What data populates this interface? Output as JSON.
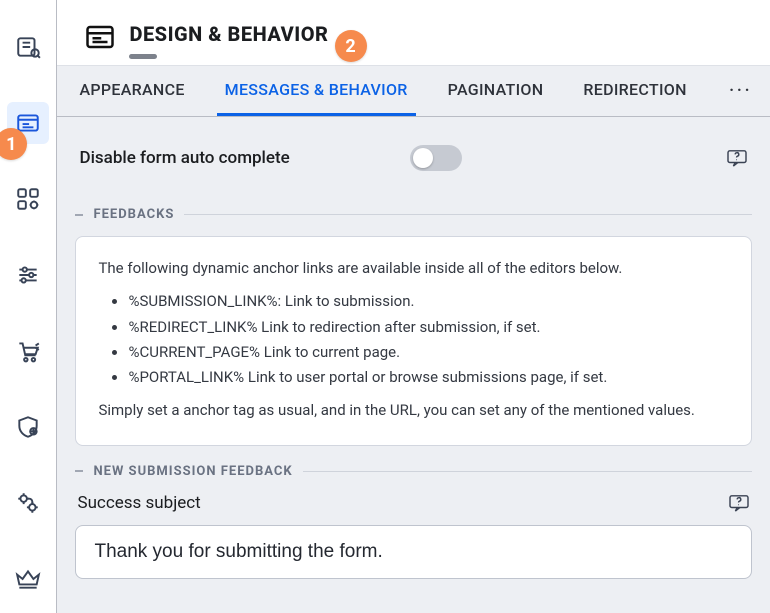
{
  "header": {
    "title": "DESIGN & BEHAVIOR"
  },
  "tabs": {
    "items": [
      {
        "label": "APPEARANCE"
      },
      {
        "label": "MESSAGES & BEHAVIOR"
      },
      {
        "label": "PAGINATION"
      },
      {
        "label": "REDIRECTION"
      }
    ],
    "more": "···"
  },
  "autocomplete": {
    "label": "Disable form auto complete"
  },
  "sections": {
    "feedbacks": {
      "title": "FEEDBACKS"
    },
    "newSubmission": {
      "title": "NEW SUBMISSION FEEDBACK"
    }
  },
  "feedbackCard": {
    "intro": "The following dynamic anchor links are available inside all of the editors below.",
    "items": {
      "0": "%SUBMISSION_LINK%: Link to submission.",
      "1": "%REDIRECT_LINK% Link to redirection after submission, if set.",
      "2": "%CURRENT_PAGE% Link to current page.",
      "3": "%PORTAL_LINK% Link to user portal or browse submissions page, if set."
    },
    "outro": "Simply set a anchor tag as usual, and in the URL, you can set any of the mentioned values."
  },
  "successSubject": {
    "label": "Success subject",
    "value": "Thank you for submitting the form."
  },
  "badges": {
    "one": "1",
    "two": "2"
  }
}
